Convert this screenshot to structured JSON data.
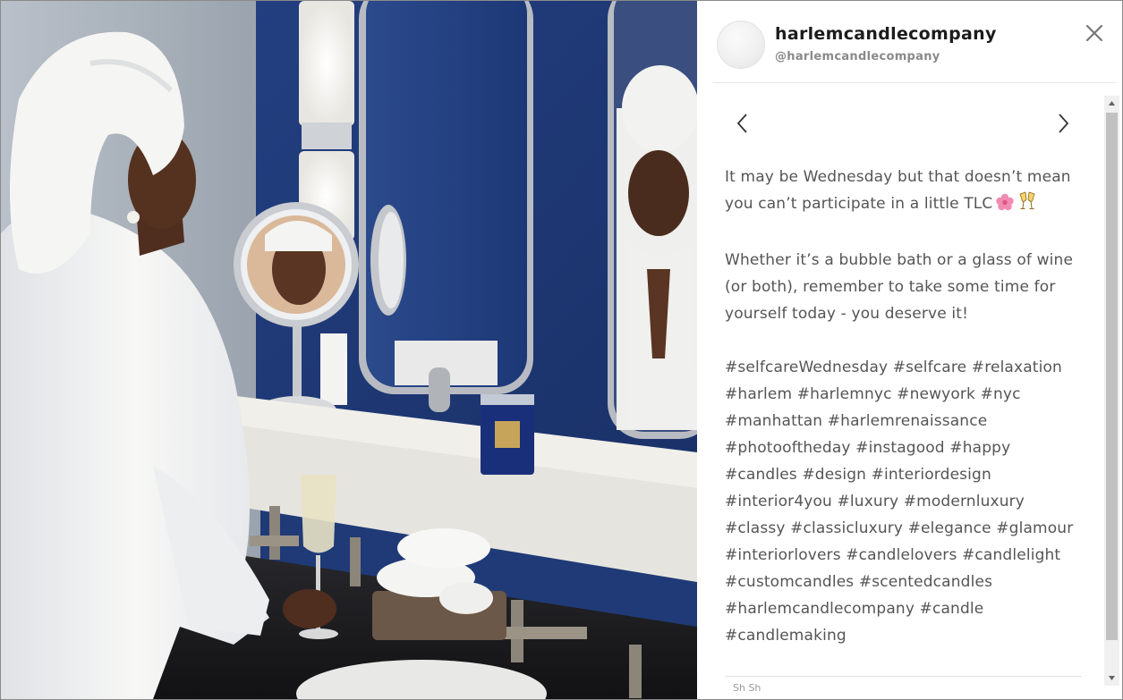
{
  "post": {
    "username": "harlemcandlecompany",
    "handle": "@harlemcandlecompany",
    "caption": {
      "line1": "It may be Wednesday but that doesn’t mean you can’t participate in a little TLC",
      "line2": "Whether it’s a bubble bath or a glass of wine (or both), remember to take some time for yourself today - you deserve it!",
      "hashtags": "#selfcareWednesday #selfcare #relaxation #harlem #harlemnyc #newyork #nyc #manhattan #harlemrenaissance #photooftheday #instagood #happy #candles #design #interiordesign #interior4you #luxury #modernluxury #classy #classicluxury #elegance #glamour #interiorlovers #candlelovers #candlelight #customcandles #scentedcandles #harlemcandlecompany #candle #candlemaking"
    },
    "emojis": [
      "flower-emoji",
      "clinking-glasses-emoji"
    ],
    "footer_peek": "Sh Sh"
  },
  "icons": {
    "close": "close-icon",
    "prev": "chevron-left-icon",
    "next": "chevron-right-icon"
  },
  "colors": {
    "wall_blue": "#1f3a77",
    "text_grey": "#555555",
    "username_dark": "#1c1c1c",
    "handle_grey": "#8a8a8a"
  }
}
